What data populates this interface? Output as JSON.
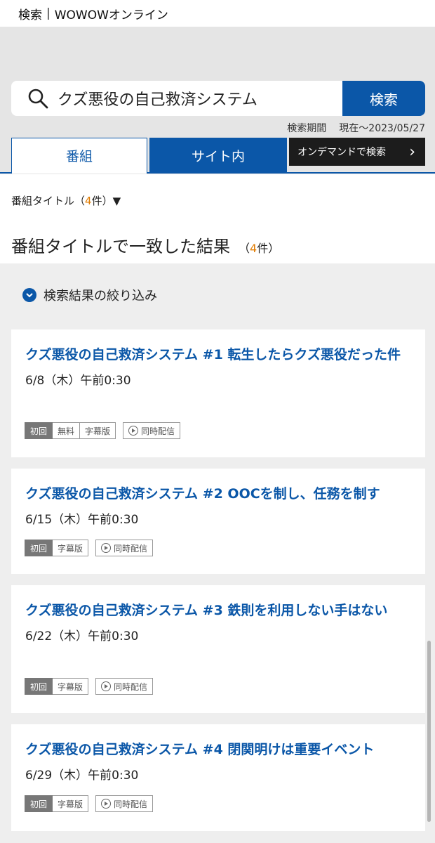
{
  "topbar": {
    "title": "検索",
    "separator": "|",
    "site": "WOWOWオンライン"
  },
  "search": {
    "query": "クズ悪役の自己救済システム",
    "button": "検索",
    "period_label": "検索期間",
    "period_value": "現在～2023/05/27"
  },
  "tabs": [
    {
      "label": "番組",
      "active": true
    },
    {
      "label": "サイト内",
      "active": false
    },
    {
      "label": "オンデマンドで検索",
      "chevron": "›"
    }
  ],
  "filter": {
    "prefix": "番組タイトル（",
    "count": "4",
    "suffix": "件）▼"
  },
  "result_heading": {
    "text": "番組タイトルで一致した結果",
    "open": "（",
    "count": "4",
    "close": "件）"
  },
  "refine": {
    "label": "検索結果の絞り込み",
    "icon": "chevron-down-circle-icon"
  },
  "programs": [
    {
      "title": "クズ悪役の自己救済システム #1 転生したらクズ悪役だった件",
      "date": "6/8（木）午前0:30",
      "badges": [
        "初回",
        "無料",
        "字幕版"
      ],
      "live": "同時配信"
    },
    {
      "title": "クズ悪役の自己救済システム #2 OOCを制し、任務を制す",
      "date": "6/15（木）午前0:30",
      "badges": [
        "初回",
        "字幕版"
      ],
      "live": "同時配信"
    },
    {
      "title": "クズ悪役の自己救済システム #3 鉄則を利用しない手はない",
      "date": "6/22（木）午前0:30",
      "badges": [
        "初回",
        "字幕版"
      ],
      "live": "同時配信"
    },
    {
      "title": "クズ悪役の自己救済システム #4 閉関明けは重要イベント",
      "date": "6/29（木）午前0:30",
      "badges": [
        "初回",
        "字幕版"
      ],
      "live": "同時配信"
    }
  ],
  "colors": {
    "brand_blue": "#0b57a8",
    "accent_orange": "#e07b00",
    "dark_tab": "#1c1c1c"
  }
}
